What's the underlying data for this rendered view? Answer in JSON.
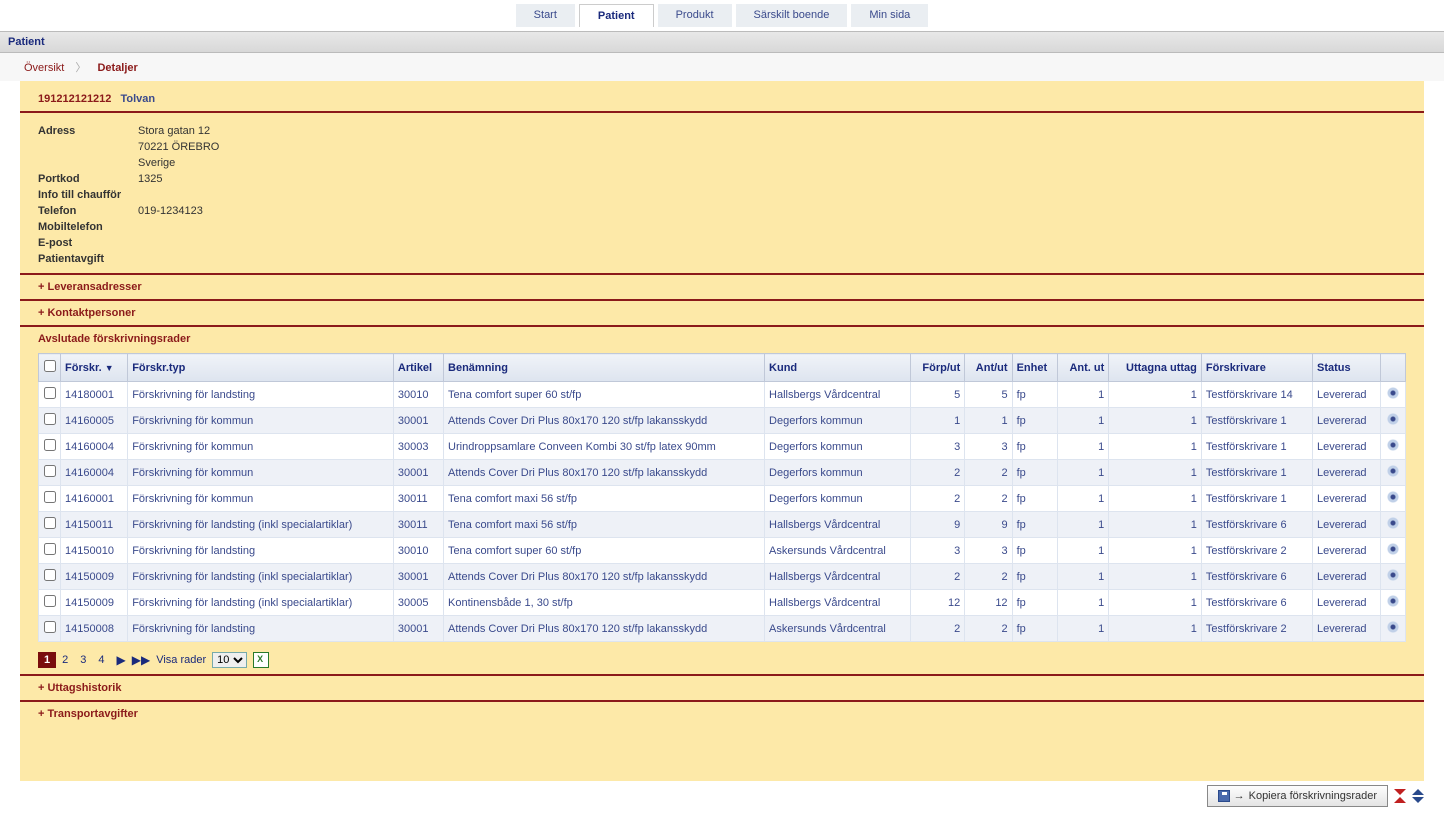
{
  "nav": {
    "items": [
      "Start",
      "Patient",
      "Produkt",
      "Särskilt boende",
      "Min sida"
    ],
    "active": 1
  },
  "page_title": "Patient",
  "breadcrumb": {
    "overview": "Översikt",
    "current": "Detaljer"
  },
  "patient": {
    "id": "191212121212",
    "name": "Tolvan"
  },
  "info": {
    "labels": {
      "adress": "Adress",
      "portkod": "Portkod",
      "info_chauffor": "Info till chaufför",
      "telefon": "Telefon",
      "mobil": "Mobiltelefon",
      "epost": "E-post",
      "avgift": "Patientavgift"
    },
    "adress_l1": "Stora gatan 12",
    "adress_l2": "70221 ÖREBRO",
    "adress_l3": "Sverige",
    "portkod": "1325",
    "info_chauffor": "",
    "telefon": "019-1234123",
    "mobil": "",
    "epost": "",
    "avgift": ""
  },
  "sections": {
    "leveransadresser": "+ Leveransadresser",
    "kontaktpersoner": "+ Kontaktpersoner",
    "avslutade": "Avslutade förskrivningsrader",
    "uttagshistorik": "+ Uttagshistorik",
    "transportavgifter": "+ Transportavgifter"
  },
  "table": {
    "headers": {
      "forskr": "Förskr.",
      "forskrtyp": "Förskr.typ",
      "artikel": "Artikel",
      "benamning": "Benämning",
      "kund": "Kund",
      "forput": "Förp/ut",
      "antut": "Ant/ut",
      "enhet": "Enhet",
      "ant_ut": "Ant. ut",
      "uttagna": "Uttagna uttag",
      "forskrivare": "Förskrivare",
      "status": "Status"
    },
    "rows": [
      {
        "forskr": "14180001",
        "typ": "Förskrivning för landsting",
        "art": "30010",
        "ben": "Tena comfort super 60 st/fp",
        "kund": "Hallsbergs Vårdcentral",
        "forput": "5",
        "antut": "5",
        "enh": "fp",
        "aut": "1",
        "utt": "1",
        "skriv": "Testförskrivare 14",
        "stat": "Levererad"
      },
      {
        "forskr": "14160005",
        "typ": "Förskrivning för kommun",
        "art": "30001",
        "ben": "Attends Cover Dri Plus 80x170 120 st/fp lakansskydd",
        "kund": "Degerfors kommun",
        "forput": "1",
        "antut": "1",
        "enh": "fp",
        "aut": "1",
        "utt": "1",
        "skriv": "Testförskrivare 1",
        "stat": "Levererad"
      },
      {
        "forskr": "14160004",
        "typ": "Förskrivning för kommun",
        "art": "30003",
        "ben": "Urindroppsamlare Conveen Kombi 30 st/fp latex 90mm",
        "kund": "Degerfors kommun",
        "forput": "3",
        "antut": "3",
        "enh": "fp",
        "aut": "1",
        "utt": "1",
        "skriv": "Testförskrivare 1",
        "stat": "Levererad"
      },
      {
        "forskr": "14160004",
        "typ": "Förskrivning för kommun",
        "art": "30001",
        "ben": "Attends Cover Dri Plus 80x170 120 st/fp lakansskydd",
        "kund": "Degerfors kommun",
        "forput": "2",
        "antut": "2",
        "enh": "fp",
        "aut": "1",
        "utt": "1",
        "skriv": "Testförskrivare 1",
        "stat": "Levererad"
      },
      {
        "forskr": "14160001",
        "typ": "Förskrivning för kommun",
        "art": "30011",
        "ben": "Tena comfort maxi 56 st/fp",
        "kund": "Degerfors kommun",
        "forput": "2",
        "antut": "2",
        "enh": "fp",
        "aut": "1",
        "utt": "1",
        "skriv": "Testförskrivare 1",
        "stat": "Levererad"
      },
      {
        "forskr": "14150011",
        "typ": "Förskrivning för landsting (inkl specialartiklar)",
        "art": "30011",
        "ben": "Tena comfort maxi 56 st/fp",
        "kund": "Hallsbergs Vårdcentral",
        "forput": "9",
        "antut": "9",
        "enh": "fp",
        "aut": "1",
        "utt": "1",
        "skriv": "Testförskrivare 6",
        "stat": "Levererad"
      },
      {
        "forskr": "14150010",
        "typ": "Förskrivning för landsting",
        "art": "30010",
        "ben": "Tena comfort super 60 st/fp",
        "kund": "Askersunds Vårdcentral",
        "forput": "3",
        "antut": "3",
        "enh": "fp",
        "aut": "1",
        "utt": "1",
        "skriv": "Testförskrivare 2",
        "stat": "Levererad"
      },
      {
        "forskr": "14150009",
        "typ": "Förskrivning för landsting (inkl specialartiklar)",
        "art": "30001",
        "ben": "Attends Cover Dri Plus 80x170 120 st/fp lakansskydd",
        "kund": "Hallsbergs Vårdcentral",
        "forput": "2",
        "antut": "2",
        "enh": "fp",
        "aut": "1",
        "utt": "1",
        "skriv": "Testförskrivare 6",
        "stat": "Levererad"
      },
      {
        "forskr": "14150009",
        "typ": "Förskrivning för landsting (inkl specialartiklar)",
        "art": "30005",
        "ben": "Kontinensbåde 1, 30 st/fp",
        "kund": "Hallsbergs Vårdcentral",
        "forput": "12",
        "antut": "12",
        "enh": "fp",
        "aut": "1",
        "utt": "1",
        "skriv": "Testförskrivare 6",
        "stat": "Levererad"
      },
      {
        "forskr": "14150008",
        "typ": "Förskrivning för landsting",
        "art": "30001",
        "ben": "Attends Cover Dri Plus 80x170 120 st/fp lakansskydd",
        "kund": "Askersunds Vårdcentral",
        "forput": "2",
        "antut": "2",
        "enh": "fp",
        "aut": "1",
        "utt": "1",
        "skriv": "Testförskrivare 2",
        "stat": "Levererad"
      }
    ]
  },
  "pager": {
    "pages": [
      "1",
      "2",
      "3",
      "4"
    ],
    "active": 0,
    "label": "Visa rader",
    "options": [
      "10"
    ],
    "selected": "10"
  },
  "copy_btn": "Kopiera förskrivningsrader"
}
